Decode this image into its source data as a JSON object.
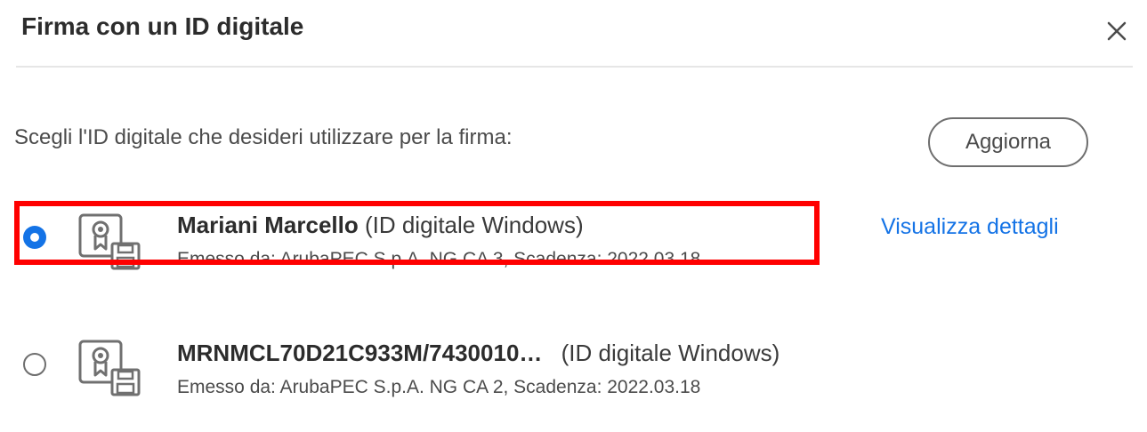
{
  "dialog": {
    "title": "Firma con un ID digitale",
    "close_icon": "close-icon",
    "prompt": "Scegli l'ID digitale che desideri utilizzare per la firma:",
    "refresh_label": "Aggiorna"
  },
  "ids": [
    {
      "selected": true,
      "name": "Mariani Marcello",
      "type": "(ID digitale Windows)",
      "issuer": "Emesso da: ArubaPEC S.p.A. NG CA 3, Scadenza: 2022.03.18",
      "details_link": "Visualizza dettagli",
      "icon": "certificate-icon"
    },
    {
      "selected": false,
      "name": "MRNMCL70D21C933M/7430010…",
      "type": "(ID digitale Windows)",
      "issuer": "Emesso da: ArubaPEC S.p.A. NG CA 2, Scadenza: 2022.03.18",
      "icon": "certificate-icon"
    }
  ],
  "colors": {
    "accent": "#1473e6",
    "highlight": "#ff0000",
    "text": "#2c2c2c"
  }
}
